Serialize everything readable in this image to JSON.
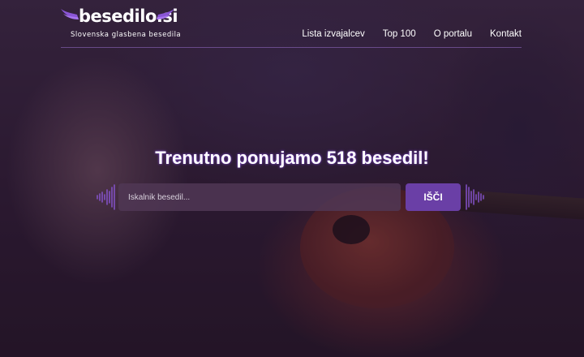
{
  "brand": {
    "name": "besedilo.si",
    "tagline": "Slovenska glasbena besedila",
    "accent_color": "#7a45c8"
  },
  "nav": {
    "items": [
      {
        "label": "Lista izvajalcev"
      },
      {
        "label": "Top 100"
      },
      {
        "label": "O portalu"
      },
      {
        "label": "Kontakt"
      }
    ]
  },
  "hero": {
    "headline": "Trenutno ponujamo 518 besedil!",
    "search_placeholder": "Iskalnik besedil...",
    "search_value": "",
    "search_button": "IŠČI",
    "button_color": "#6a3fa6"
  },
  "icons": {
    "logo_wings": "wing-icon",
    "sound_wave": "sound-wave-icon"
  }
}
